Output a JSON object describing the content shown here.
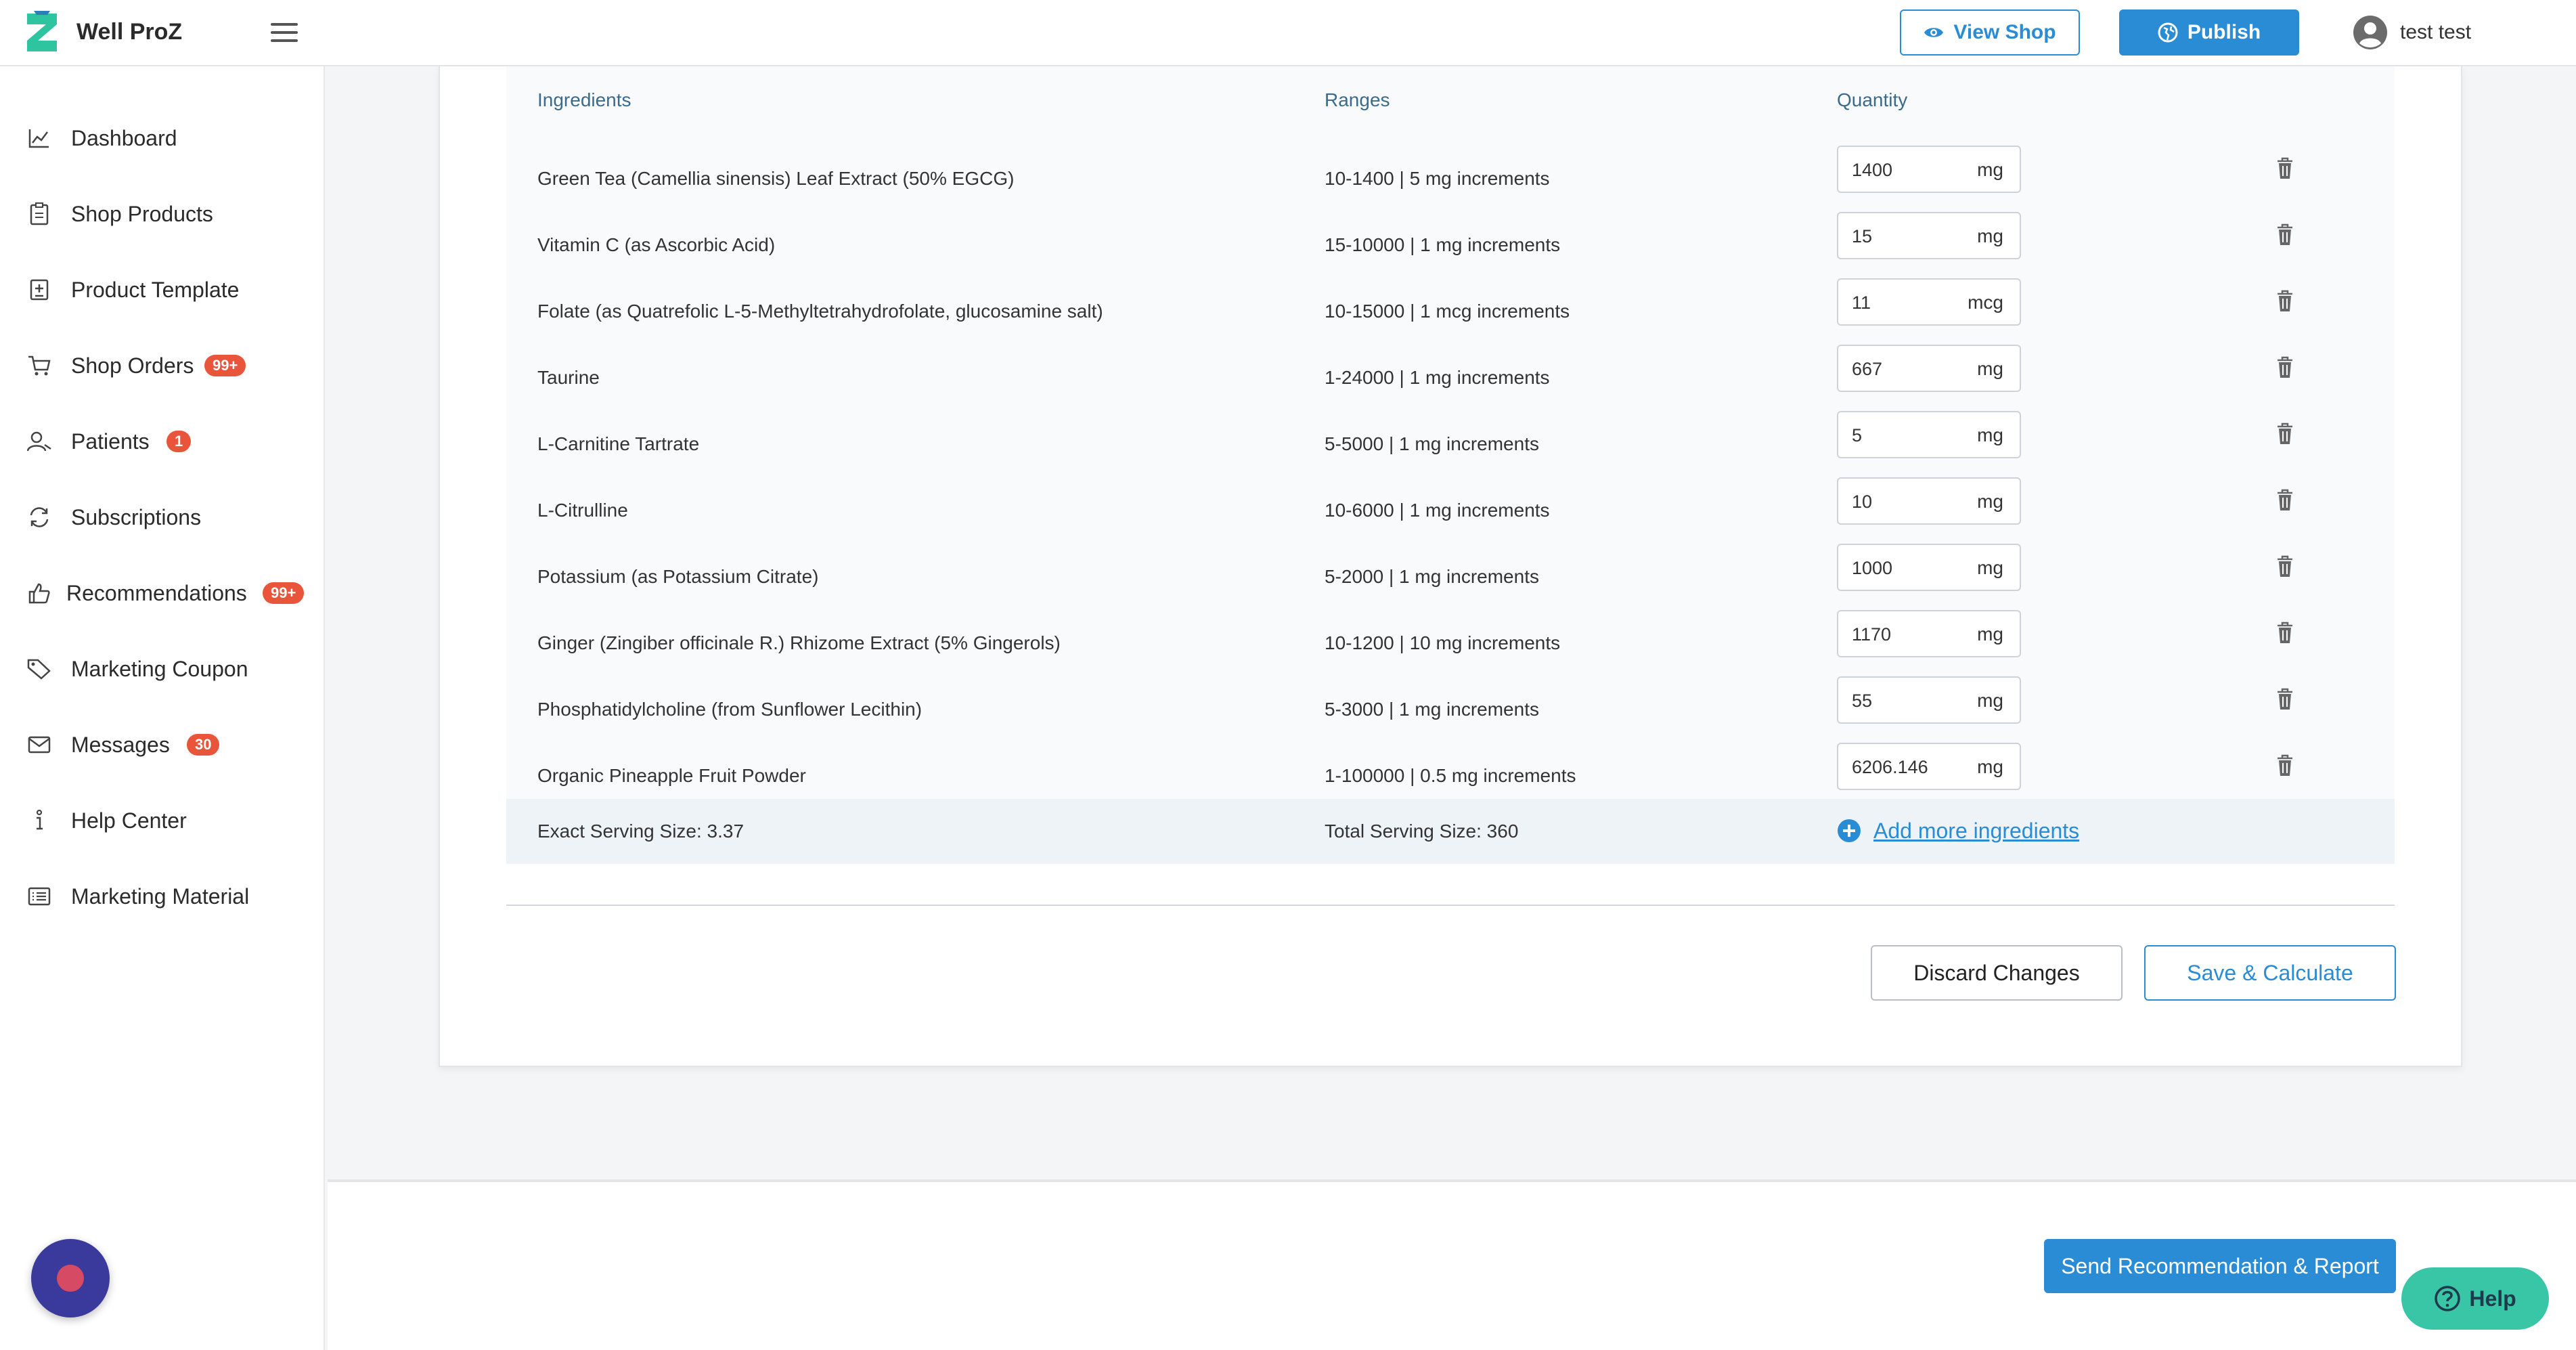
{
  "app": {
    "brand": "Well ProZ"
  },
  "header": {
    "view_shop": "View Shop",
    "publish": "Publish",
    "user_name": "test test"
  },
  "sidebar": {
    "items": [
      {
        "label": "Dashboard",
        "icon": "chart-line-icon"
      },
      {
        "label": "Shop Products",
        "icon": "clipboard-icon"
      },
      {
        "label": "Product Template",
        "icon": "template-icon"
      },
      {
        "label": "Shop Orders",
        "icon": "cart-icon",
        "badge": "99+"
      },
      {
        "label": "Patients",
        "icon": "user-icon",
        "badge": "1"
      },
      {
        "label": "Subscriptions",
        "icon": "refresh-icon"
      },
      {
        "label": "Recommendations",
        "icon": "thumbs-up-icon",
        "badge": "99+"
      },
      {
        "label": "Marketing Coupon",
        "icon": "tag-icon"
      },
      {
        "label": "Messages",
        "icon": "mail-icon",
        "badge": "30"
      },
      {
        "label": "Help Center",
        "icon": "info-icon"
      },
      {
        "label": "Marketing Material",
        "icon": "list-icon"
      }
    ]
  },
  "table": {
    "headers": {
      "ingredients": "Ingredients",
      "ranges": "Ranges",
      "quantity": "Quantity"
    },
    "rows": [
      {
        "name": "Green Tea (Camellia sinensis) Leaf Extract (50% EGCG)",
        "range": "10-1400 | 5 mg increments",
        "qty": "1400",
        "unit": "mg"
      },
      {
        "name": "Vitamin C (as Ascorbic Acid)",
        "range": "15-10000 | 1 mg increments",
        "qty": "15",
        "unit": "mg"
      },
      {
        "name": "Folate (as Quatrefolic L-5-Methyltetrahydrofolate, glucosamine salt)",
        "range": "10-15000 | 1 mcg increments",
        "qty": "11",
        "unit": "mcg"
      },
      {
        "name": "Taurine",
        "range": "1-24000 | 1 mg increments",
        "qty": "667",
        "unit": "mg"
      },
      {
        "name": "L-Carnitine Tartrate",
        "range": "5-5000 | 1 mg increments",
        "qty": "5",
        "unit": "mg"
      },
      {
        "name": "L-Citrulline",
        "range": "10-6000 | 1 mg increments",
        "qty": "10",
        "unit": "mg"
      },
      {
        "name": "Potassium (as Potassium Citrate)",
        "range": "5-2000 | 1 mg increments",
        "qty": "1000",
        "unit": "mg"
      },
      {
        "name": "Ginger (Zingiber officinale R.) Rhizome Extract (5% Gingerols)",
        "range": "10-1200 | 10 mg increments",
        "qty": "1170",
        "unit": "mg"
      },
      {
        "name": "Phosphatidylcholine (from Sunflower Lecithin)",
        "range": "5-3000 | 1 mg increments",
        "qty": "55",
        "unit": "mg"
      },
      {
        "name": "Organic Pineapple Fruit Powder",
        "range": "1-100000 | 0.5 mg increments",
        "qty": "6206.146",
        "unit": "mg"
      }
    ],
    "summary": {
      "exact_serving": "Exact Serving Size: 3.37",
      "total_serving": "Total Serving Size: 360",
      "add_more": "Add more ingredients"
    }
  },
  "actions": {
    "discard": "Discard Changes",
    "save": "Save & Calculate",
    "send": "Send Recommendation & Report",
    "help": "Help"
  },
  "colors": {
    "accent": "#2b8cd6",
    "badge": "#e8553a",
    "help": "#38c6a6",
    "chat": "#3a3a9c"
  }
}
